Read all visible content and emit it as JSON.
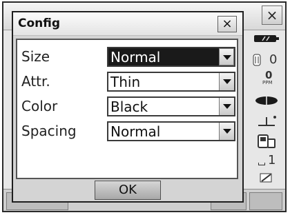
{
  "window": {
    "close_label": "×"
  },
  "dialog": {
    "title": "Config",
    "close_label": "×",
    "ok_label": "OK",
    "rows": [
      {
        "label": "Size",
        "value": "Normal",
        "selected": true
      },
      {
        "label": "Attr.",
        "value": "Thin",
        "selected": false
      },
      {
        "label": "Color",
        "value": "Black",
        "selected": false
      },
      {
        "label": "Spacing",
        "value": "Normal",
        "selected": false
      }
    ]
  },
  "status": {
    "prism_constant": "0",
    "ppm_value": "0",
    "ppm_unit": "PPM",
    "mode_number": "1"
  },
  "icons": [
    "battery-icon",
    "prism-icon",
    "ppm-icon",
    "laser-icon",
    "tilt-icon",
    "memory-card-icon",
    "input-mode-icon",
    "pen-icon"
  ]
}
